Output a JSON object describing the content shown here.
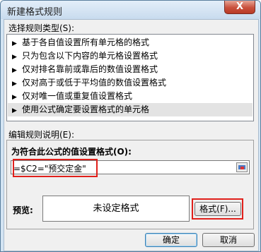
{
  "window": {
    "title": "新建格式规则",
    "close_label": "X"
  },
  "rule_type": {
    "label": "选择规则类型(S):",
    "items": [
      "基于各自值设置所有单元格的格式",
      "只为包含以下内容的单元格设置格式",
      "仅对排名靠前或靠后的数值设置格式",
      "仅对高于或低于平均值的数值设置格式",
      "仅对唯一值或重复值设置格式",
      "使用公式确定要设置格式的单元格"
    ],
    "selected_index": 5,
    "bullet": "▶"
  },
  "rule_description": {
    "label": "编辑规则说明(E):",
    "formula_label": "为符合此公式的值设置格式(O):",
    "formula_value": "=$C2=\"预交定金\"",
    "preview_label": "预览:",
    "preview_text": "未设定格式",
    "format_button": "格式(F)..."
  },
  "footer": {
    "ok_button": "确定",
    "cancel_button": "取消"
  },
  "colors": {
    "highlight": "#e0201b",
    "selected_row": "#e3e3e3"
  },
  "icons": {
    "range_selector": "range-select-icon"
  }
}
